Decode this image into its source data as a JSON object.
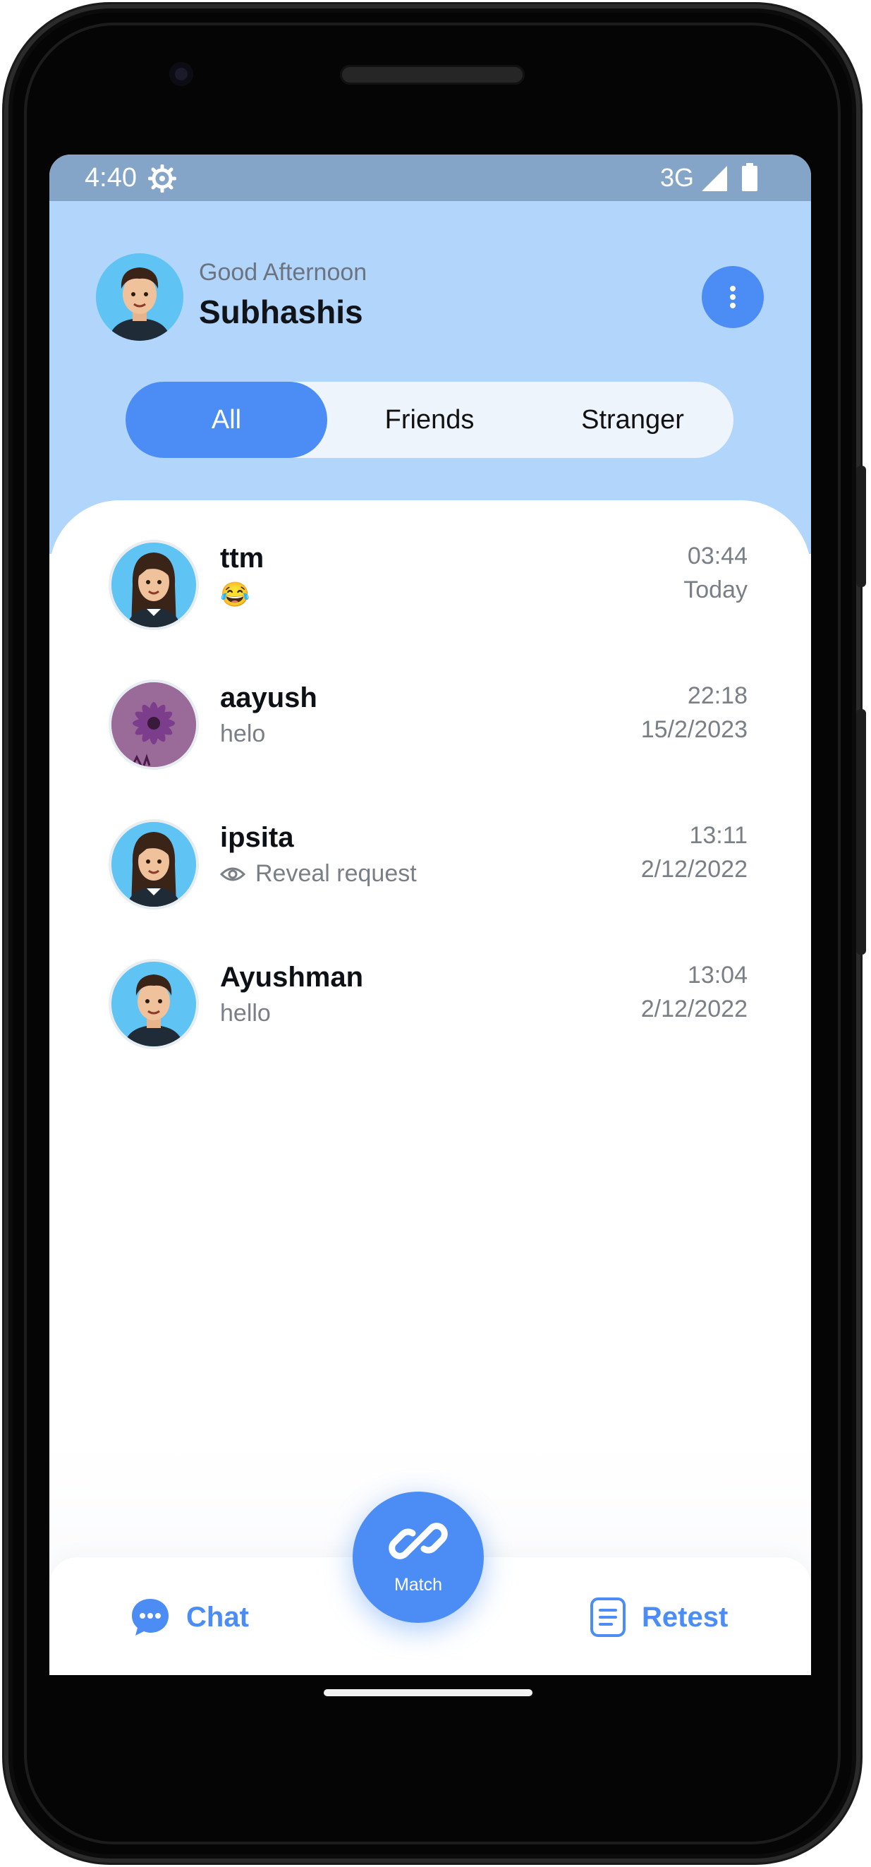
{
  "status_bar": {
    "time": "4:40",
    "network": "3G"
  },
  "header": {
    "greeting": "Good Afternoon",
    "username": "Subhashis"
  },
  "tabs": [
    {
      "label": "All",
      "active": true
    },
    {
      "label": "Friends",
      "active": false
    },
    {
      "label": "Stranger",
      "active": false
    }
  ],
  "chats": [
    {
      "name": "ttm",
      "preview": "😂",
      "time": "03:44",
      "date": "Today",
      "avatar": "girl"
    },
    {
      "name": "aayush",
      "preview": "helo",
      "time": "22:18",
      "date": "15/2/2023",
      "avatar": "flower"
    },
    {
      "name": "ipsita",
      "preview": "Reveal request",
      "time": "13:11",
      "date": "2/12/2022",
      "avatar": "girl",
      "preview_icon": "eye-icon"
    },
    {
      "name": "Ayushman",
      "preview": "hello",
      "time": "13:04",
      "date": "2/12/2022",
      "avatar": "boy"
    }
  ],
  "bottom_nav": {
    "chat_label": "Chat",
    "match_label": "Match",
    "retest_label": "Retest"
  },
  "colors": {
    "accent": "#4b8df5",
    "hero_bg": "#b1d5fb",
    "status_bar": "#85a5c8"
  }
}
